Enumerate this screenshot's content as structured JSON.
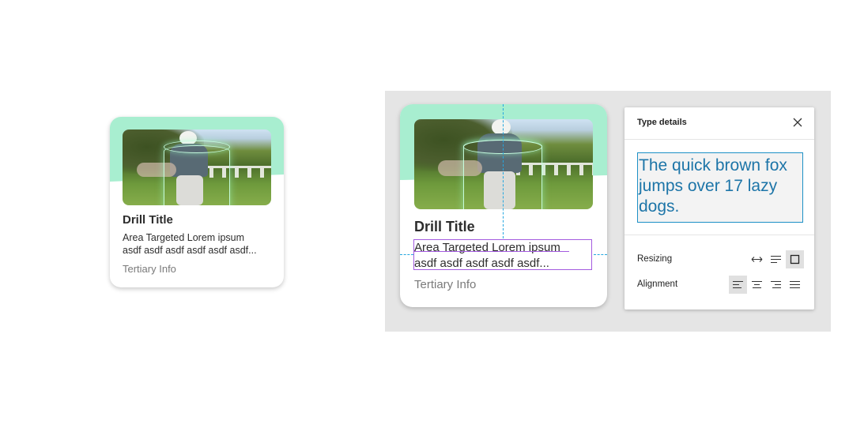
{
  "card_small": {
    "title": "Drill Title",
    "desc_line1": "Area Targeted Lorem ipsum",
    "desc_line2": "asdf asdf asdf asdf asdf asdf...",
    "tertiary": "Tertiary Info"
  },
  "card_large": {
    "title": "Drill Title",
    "desc_line1": "Area Targeted Lorem ipsum",
    "desc_line2": "asdf asdf asdf asdf asdf...",
    "tertiary": "Tertiary Info"
  },
  "type_panel": {
    "header": "Type details",
    "preview_line1": "The quick brown fox",
    "preview_line2": "jumps over 17 lazy",
    "preview_line3": "dogs.",
    "resizing_label": "Resizing",
    "alignment_label": "Alignment",
    "resizing_options": [
      "auto-width-icon",
      "auto-height-icon",
      "fixed-size-icon"
    ],
    "resizing_selected": "fixed-size-icon",
    "alignment_options": [
      "align-left-icon",
      "align-center-icon",
      "align-right-icon",
      "align-justify-icon"
    ],
    "alignment_selected": "align-left-icon"
  },
  "colors": {
    "mint_accent": "#a8eed0",
    "selection": "#a45ce0",
    "guide": "#25a7e0",
    "preview_text": "#1d75a8"
  }
}
